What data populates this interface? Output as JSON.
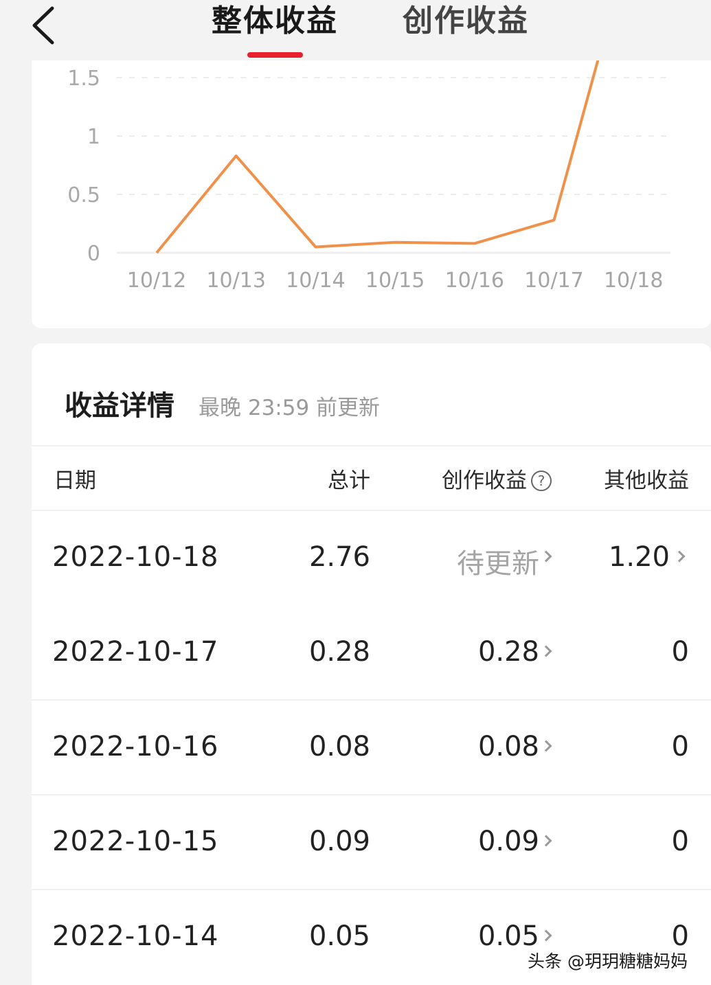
{
  "header": {
    "back_icon": "chevron-left-icon",
    "tabs": [
      {
        "label": "整体收益",
        "active": true
      },
      {
        "label": "创作收益",
        "active": false
      }
    ],
    "active_color": "#e8202e"
  },
  "chart_data": {
    "type": "line",
    "categories": [
      "10/12",
      "10/13",
      "10/14",
      "10/15",
      "10/16",
      "10/17",
      "10/18"
    ],
    "series": [
      {
        "values": [
          0.0,
          0.83,
          0.05,
          0.09,
          0.08,
          0.28,
          2.76
        ],
        "color": "#f0914b"
      }
    ],
    "y_ticks": [
      "0",
      "0.5",
      "1",
      "1.5"
    ],
    "ylim": [
      0,
      1.5
    ],
    "clipped_top": true,
    "grid": "dashed horizontal",
    "title": "",
    "xlabel": "",
    "ylabel": ""
  },
  "detail": {
    "title": "收益详情",
    "subtitle": "最晚 23:59 前更新",
    "columns": {
      "date": "日期",
      "total": "总计",
      "creation": "创作收益",
      "other": "其他收益"
    },
    "help_icon": "question-circle-icon",
    "rows": [
      {
        "date": "2022-10-18",
        "total": "2.76",
        "creation": "待更新",
        "other": "1.20"
      },
      {
        "date": "2022-10-17",
        "total": "0.28",
        "creation": "0.28",
        "other": "0"
      },
      {
        "date": "2022-10-16",
        "total": "0.08",
        "creation": "0.08",
        "other": "0"
      },
      {
        "date": "2022-10-15",
        "total": "0.09",
        "creation": "0.09",
        "other": "0"
      },
      {
        "date": "2022-10-14",
        "total": "0.05",
        "creation": "0.05",
        "other": "0"
      }
    ]
  },
  "watermark": "头条 @玥玥糖糖妈妈"
}
